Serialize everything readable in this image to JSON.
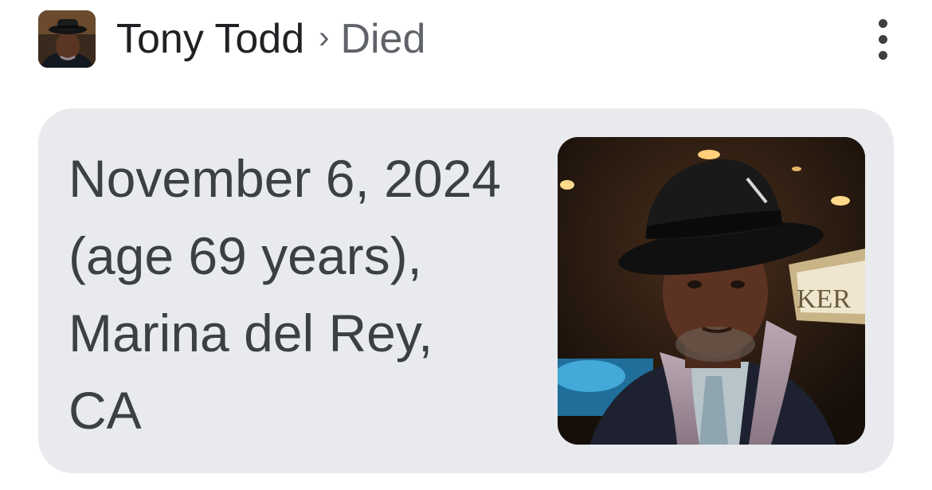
{
  "header": {
    "entity": "Tony Todd",
    "separator": "›",
    "attribute": "Died"
  },
  "answer": {
    "text": "November 6, 2024 (age 69 years), Marina del Rey, CA"
  },
  "photo": {
    "sign_text": "KER"
  },
  "icons": {
    "menu": "more-vert-icon"
  },
  "colors": {
    "card_background": "#e8eaed",
    "title": "#202124",
    "secondary_text": "#5f6368"
  }
}
